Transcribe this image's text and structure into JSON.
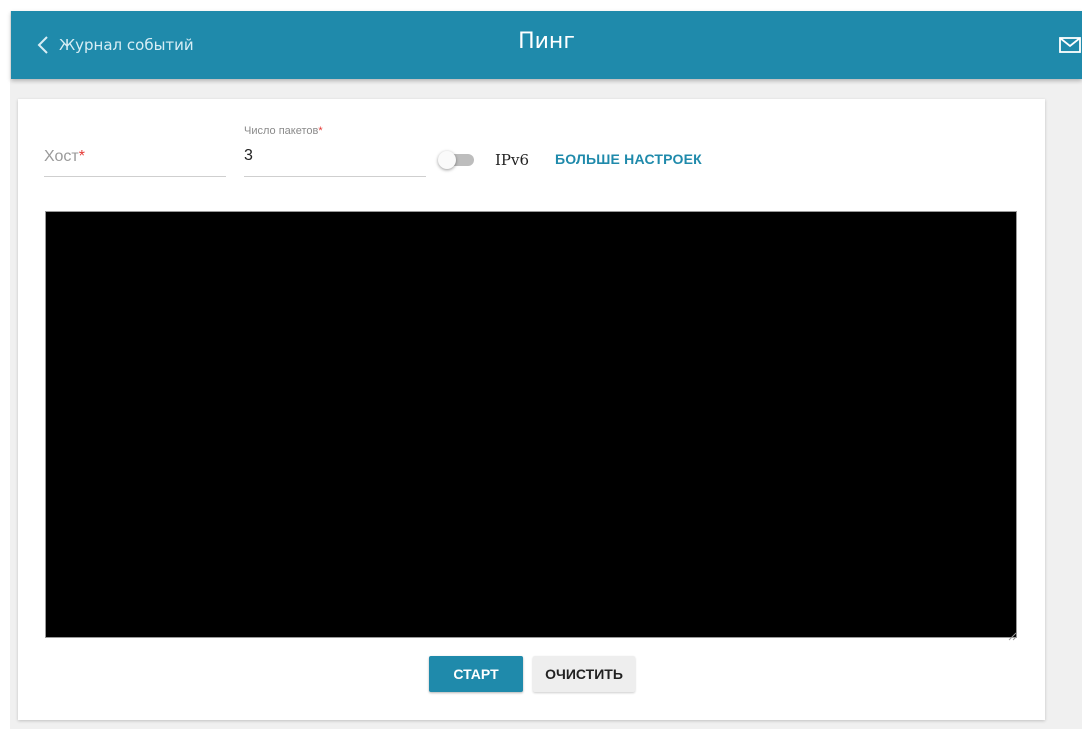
{
  "header": {
    "back_label": "Журнал событий",
    "title": "Пинг",
    "back_icon": "chevron-left-icon",
    "mail_icon": "mail-icon",
    "background_color": "#1f8aab"
  },
  "form": {
    "host": {
      "placeholder": "Хост",
      "required_mark": "*",
      "value": ""
    },
    "packet_count": {
      "label": "Число пакетов",
      "required_mark": "*",
      "value": "3"
    },
    "ipv6_toggle": {
      "label": "IPv6",
      "enabled": false
    },
    "more_settings_label": "БОЛЬШЕ НАСТРОЕК"
  },
  "console": {
    "output": ""
  },
  "actions": {
    "start_label": "СТАРТ",
    "clear_label": "ОЧИСТИТЬ"
  },
  "colors": {
    "accent": "#1f8aab",
    "required": "#e53935"
  }
}
